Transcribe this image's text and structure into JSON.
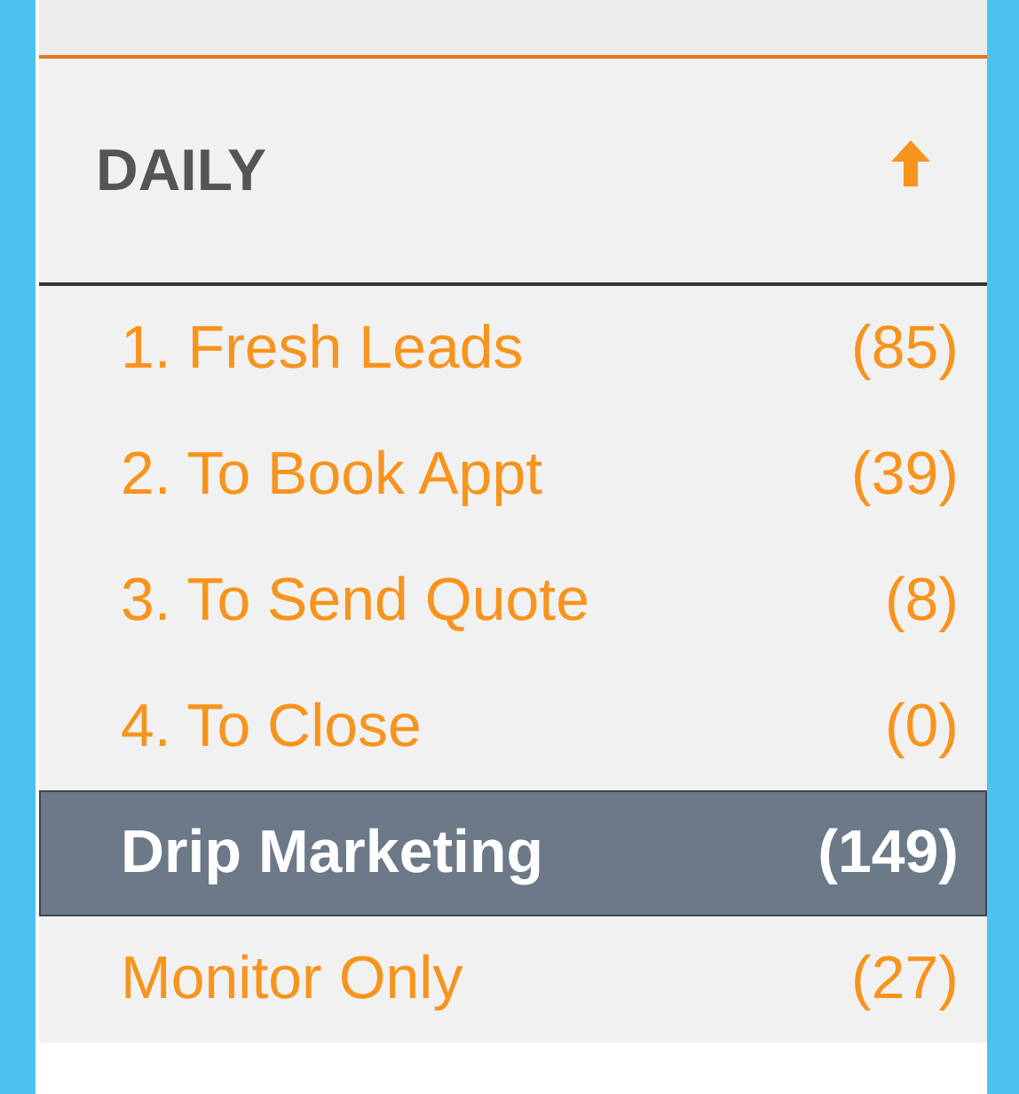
{
  "section": {
    "title": "DAILY"
  },
  "items": [
    {
      "label": "1. Fresh Leads",
      "count": "(85)",
      "selected": false
    },
    {
      "label": "2. To Book Appt",
      "count": "(39)",
      "selected": false
    },
    {
      "label": "3. To Send Quote",
      "count": "(8)",
      "selected": false
    },
    {
      "label": "4. To Close",
      "count": "(0)",
      "selected": false
    },
    {
      "label": "Drip Marketing",
      "count": "(149)",
      "selected": true
    },
    {
      "label": "Monitor Only",
      "count": "(27)",
      "selected": false
    }
  ]
}
